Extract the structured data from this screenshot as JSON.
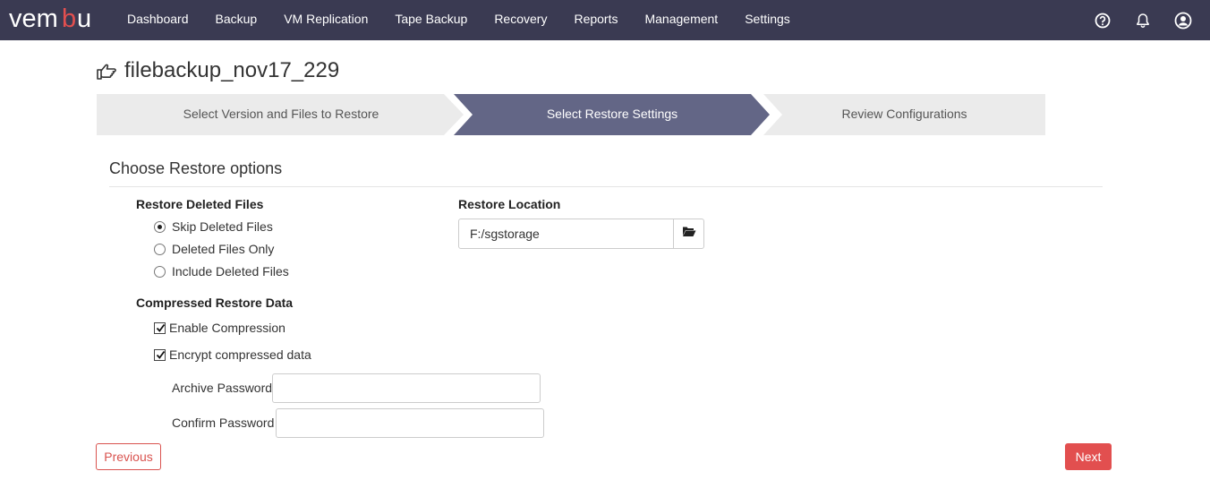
{
  "app": {
    "logo_text": "vembu",
    "brand_color": "#3a3a52",
    "logo_accent": "#e24f4f"
  },
  "nav": {
    "items": [
      {
        "label": "Dashboard"
      },
      {
        "label": "Backup"
      },
      {
        "label": "VM Replication"
      },
      {
        "label": "Tape Backup"
      },
      {
        "label": "Recovery"
      },
      {
        "label": "Reports"
      },
      {
        "label": "Management"
      },
      {
        "label": "Settings"
      }
    ],
    "icons": [
      "help-icon",
      "bell-icon",
      "user-icon"
    ]
  },
  "page": {
    "title": "filebackup_nov17_229",
    "title_icon": "hand-pointer-icon"
  },
  "wizard": {
    "steps": [
      {
        "label": "Select Version and Files to Restore",
        "active": false
      },
      {
        "label": "Select Restore Settings",
        "active": true
      },
      {
        "label": "Review Configurations",
        "active": false
      }
    ],
    "active_color": "#636686",
    "inactive_color": "#ebebeb"
  },
  "section": {
    "title": "Choose Restore options"
  },
  "restore_deleted": {
    "label": "Restore Deleted Files",
    "options": [
      {
        "label": "Skip Deleted Files",
        "checked": true
      },
      {
        "label": "Deleted Files Only",
        "checked": false
      },
      {
        "label": "Include Deleted Files",
        "checked": false
      }
    ]
  },
  "compressed": {
    "label": "Compressed Restore Data",
    "enable_compression": {
      "label": "Enable Compression",
      "checked": true
    },
    "encrypt": {
      "label": "Encrypt compressed data",
      "checked": true
    },
    "archive_password": {
      "label": "Archive Password",
      "value": ""
    },
    "confirm_password": {
      "label": "Confirm Password",
      "value": ""
    }
  },
  "restore_location": {
    "label": "Restore Location",
    "value": "F:/sgstorage",
    "browse_icon": "folder-open-icon"
  },
  "buttons": {
    "previous": "Previous",
    "next": "Next"
  }
}
